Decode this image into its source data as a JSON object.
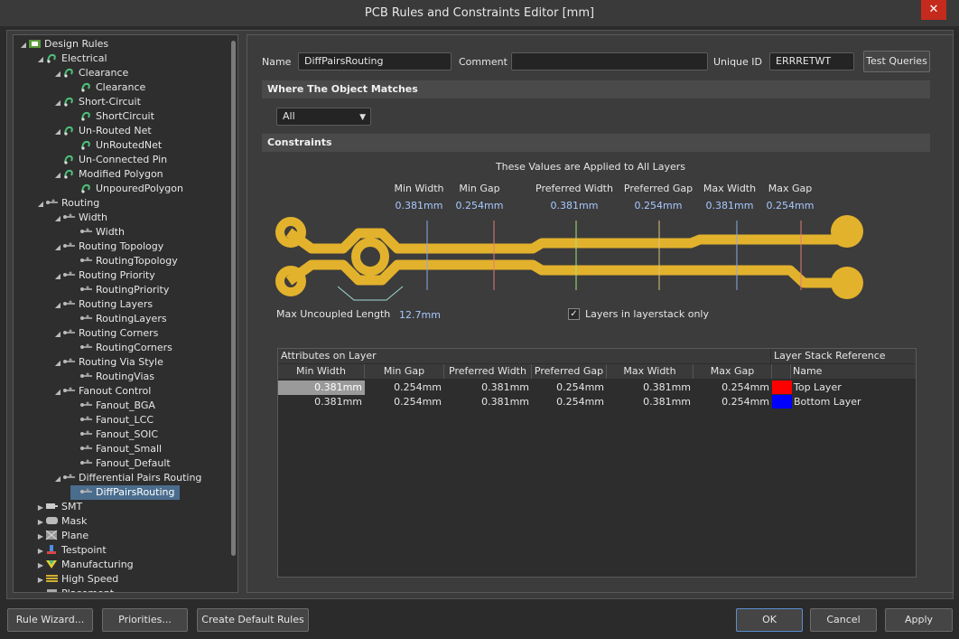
{
  "window": {
    "title": "PCB Rules and Constraints Editor [mm]",
    "close_glyph": "✕"
  },
  "tree": {
    "items": [
      {
        "label": "Design Rules",
        "arrow": "◢",
        "icon": "rules-folder-icon"
      },
      {
        "label": "Electrical",
        "arrow": "◢",
        "icon": "electrical-icon"
      },
      {
        "label": "Clearance",
        "arrow": "◢",
        "icon": "electrical-icon"
      },
      {
        "label": "Clearance",
        "arrow": "",
        "icon": "electrical-icon"
      },
      {
        "label": "Short-Circuit",
        "arrow": "◢",
        "icon": "electrical-icon"
      },
      {
        "label": "ShortCircuit",
        "arrow": "",
        "icon": "electrical-icon"
      },
      {
        "label": "Un-Routed Net",
        "arrow": "◢",
        "icon": "electrical-icon"
      },
      {
        "label": "UnRoutedNet",
        "arrow": "",
        "icon": "electrical-icon"
      },
      {
        "label": "Un-Connected Pin",
        "arrow": "",
        "icon": "electrical-icon"
      },
      {
        "label": "Modified Polygon",
        "arrow": "◢",
        "icon": "electrical-icon"
      },
      {
        "label": "UnpouredPolygon",
        "arrow": "",
        "icon": "electrical-icon"
      },
      {
        "label": "Routing",
        "arrow": "◢",
        "icon": "routing-icon"
      },
      {
        "label": "Width",
        "arrow": "◢",
        "icon": "routing-icon"
      },
      {
        "label": "Width",
        "arrow": "",
        "icon": "routing-icon"
      },
      {
        "label": "Routing Topology",
        "arrow": "◢",
        "icon": "routing-icon"
      },
      {
        "label": "RoutingTopology",
        "arrow": "",
        "icon": "routing-icon"
      },
      {
        "label": "Routing Priority",
        "arrow": "◢",
        "icon": "routing-icon"
      },
      {
        "label": "RoutingPriority",
        "arrow": "",
        "icon": "routing-icon"
      },
      {
        "label": "Routing Layers",
        "arrow": "◢",
        "icon": "routing-icon"
      },
      {
        "label": "RoutingLayers",
        "arrow": "",
        "icon": "routing-icon"
      },
      {
        "label": "Routing Corners",
        "arrow": "◢",
        "icon": "routing-icon"
      },
      {
        "label": "RoutingCorners",
        "arrow": "",
        "icon": "routing-icon"
      },
      {
        "label": "Routing Via Style",
        "arrow": "◢",
        "icon": "routing-icon"
      },
      {
        "label": "RoutingVias",
        "arrow": "",
        "icon": "routing-icon"
      },
      {
        "label": "Fanout Control",
        "arrow": "◢",
        "icon": "routing-icon"
      },
      {
        "label": "Fanout_BGA",
        "arrow": "",
        "icon": "routing-icon"
      },
      {
        "label": "Fanout_LCC",
        "arrow": "",
        "icon": "routing-icon"
      },
      {
        "label": "Fanout_SOIC",
        "arrow": "",
        "icon": "routing-icon"
      },
      {
        "label": "Fanout_Small",
        "arrow": "",
        "icon": "routing-icon"
      },
      {
        "label": "Fanout_Default",
        "arrow": "",
        "icon": "routing-icon"
      },
      {
        "label": "Differential Pairs Routing",
        "arrow": "◢",
        "icon": "routing-icon"
      },
      {
        "label": "DiffPairsRouting",
        "arrow": "",
        "icon": "routing-icon"
      },
      {
        "label": "SMT",
        "arrow": "▶",
        "icon": "smt-icon"
      },
      {
        "label": "Mask",
        "arrow": "▶",
        "icon": "mask-icon"
      },
      {
        "label": "Plane",
        "arrow": "▶",
        "icon": "plane-icon"
      },
      {
        "label": "Testpoint",
        "arrow": "▶",
        "icon": "testpoint-icon"
      },
      {
        "label": "Manufacturing",
        "arrow": "▶",
        "icon": "manufacturing-icon"
      },
      {
        "label": "High Speed",
        "arrow": "▶",
        "icon": "high-speed-icon"
      },
      {
        "label": "Placement",
        "arrow": "▶",
        "icon": "placement-icon"
      }
    ],
    "selected_label": "DiffPairsRouting"
  },
  "rule": {
    "name_label": "Name",
    "name_value": "DiffPairsRouting",
    "comment_label": "Comment",
    "comment_value": "",
    "uid_label": "Unique ID",
    "uid_value": "ERRRETWT",
    "test_queries_label": "Test Queries"
  },
  "where": {
    "section_title": "Where The Object Matches",
    "scope_value": "All"
  },
  "constraints": {
    "section_title": "Constraints",
    "applied_text": "These Values are Applied to All Layers",
    "params": [
      {
        "label": "Min Width",
        "value": "0.381mm"
      },
      {
        "label": "Min Gap",
        "value": "0.254mm"
      },
      {
        "label": "Preferred Width",
        "value": "0.381mm"
      },
      {
        "label": "Preferred Gap",
        "value": "0.254mm"
      },
      {
        "label": "Max Width",
        "value": "0.381mm"
      },
      {
        "label": "Max Gap",
        "value": "0.254mm"
      }
    ],
    "max_uncoupled_label": "Max Uncoupled Length",
    "max_uncoupled_value": "12.7mm",
    "layerstack_only_label": "Layers in layerstack only",
    "layerstack_only_checked": true,
    "check_glyph": "✓"
  },
  "grid": {
    "attributes_header": "Attributes on Layer",
    "layer_ref_header": "Layer Stack Reference",
    "columns": [
      "Min Width",
      "Min Gap",
      "Preferred Width",
      "Preferred Gap",
      "Max Width",
      "Max Gap"
    ],
    "name_column": "Name",
    "rows": [
      {
        "values": [
          "0.381mm",
          "0.254mm",
          "0.381mm",
          "0.254mm",
          "0.381mm",
          "0.254mm"
        ],
        "layer": "Top Layer",
        "color": "#ff0000"
      },
      {
        "values": [
          "0.381mm",
          "0.254mm",
          "0.381mm",
          "0.254mm",
          "0.381mm",
          "0.254mm"
        ],
        "layer": "Bottom Layer",
        "color": "#0000ff"
      }
    ]
  },
  "footer": {
    "rule_wizard": "Rule Wizard...",
    "priorities": "Priorities...",
    "create_defaults": "Create Default Rules",
    "ok": "OK",
    "cancel": "Cancel",
    "apply": "Apply"
  },
  "colors": {
    "trace": "#e3b22c",
    "accent": "#4a6d8e"
  }
}
